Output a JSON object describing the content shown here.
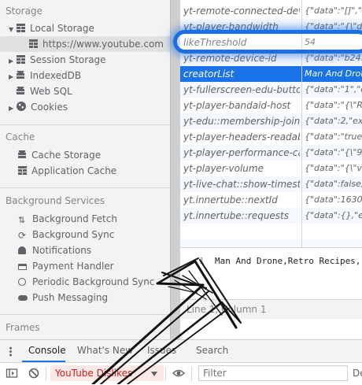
{
  "sidebar": {
    "storage_header": "Storage",
    "local_storage": "Local Storage",
    "local_storage_origin": "https://www.youtube.com",
    "session_storage": "Session Storage",
    "indexeddb": "IndexedDB",
    "websql": "Web SQL",
    "cookies": "Cookies",
    "cache_header": "Cache",
    "cache_storage": "Cache Storage",
    "application_cache": "Application Cache",
    "bg_header": "Background Services",
    "bg_fetch": "Background Fetch",
    "bg_sync": "Background Sync",
    "notifications": "Notifications",
    "payment_handler": "Payment Handler",
    "periodic_bg_sync": "Periodic Background Sync",
    "push_messaging": "Push Messaging",
    "frames_header": "Frames"
  },
  "storage_table": {
    "rows": [
      {
        "key": "yt-remote-connected-devic...",
        "value": "{\"data\":\"[]\",\"expir"
      },
      {
        "key": "yt-player-bandwidth",
        "value": "{\"data\":\"{\\\"delay"
      },
      {
        "key": "likeThreshold",
        "value": "54"
      },
      {
        "key": "yt-remote-device-id",
        "value": "{\"data\":\"b24f4"
      },
      {
        "key": "creatorList",
        "value": "Man And Drone"
      },
      {
        "key": "yt-fullerscreen-edu-button-...",
        "value": "{\"data\":\"1\",\"expi"
      },
      {
        "key": "yt-player-bandaid-host",
        "value": "{\"data\":\"{\\\"RN\\\""
      },
      {
        "key": "yt-edu::membership-join-i...",
        "value": "{\"data\":2,\"expira"
      },
      {
        "key": "yt-player-headers-readable",
        "value": "{\"data\":\"true\",\"ex"
      },
      {
        "key": "yt-player-performance-cap",
        "value": "{\"data\":\"{\\\"9p60"
      },
      {
        "key": "yt-player-volume",
        "value": "{\"data\":\"{\\\"volum"
      },
      {
        "key": "yt-live-chat::show-timesta...",
        "value": "{\"data\":false,\"ex"
      },
      {
        "key": "yt.innertube::nextId",
        "value": "{\"data\":1630,\"ex"
      },
      {
        "key": "yt.innertube::requests",
        "value": "{\"data\":{},\"expira"
      }
    ],
    "selected_index": 4,
    "highlighted_index": 2
  },
  "preview": {
    "line_number": "1",
    "text": "Man And Drone,Retro Recipes,",
    "status": "Line 1, Column 1"
  },
  "drawer": {
    "tabs": [
      "Console",
      "What's New",
      "Issues",
      "Search"
    ],
    "active_tab": "Console"
  },
  "console_toolbar": {
    "context": "YouTube Dislikes",
    "filter_placeholder": "Filter",
    "levels_label": "De"
  },
  "colors": {
    "accent": "#1a73e8",
    "highlight": "#1a6fe6",
    "context_bg": "#fce8e6",
    "context_text": "#c5221f"
  }
}
